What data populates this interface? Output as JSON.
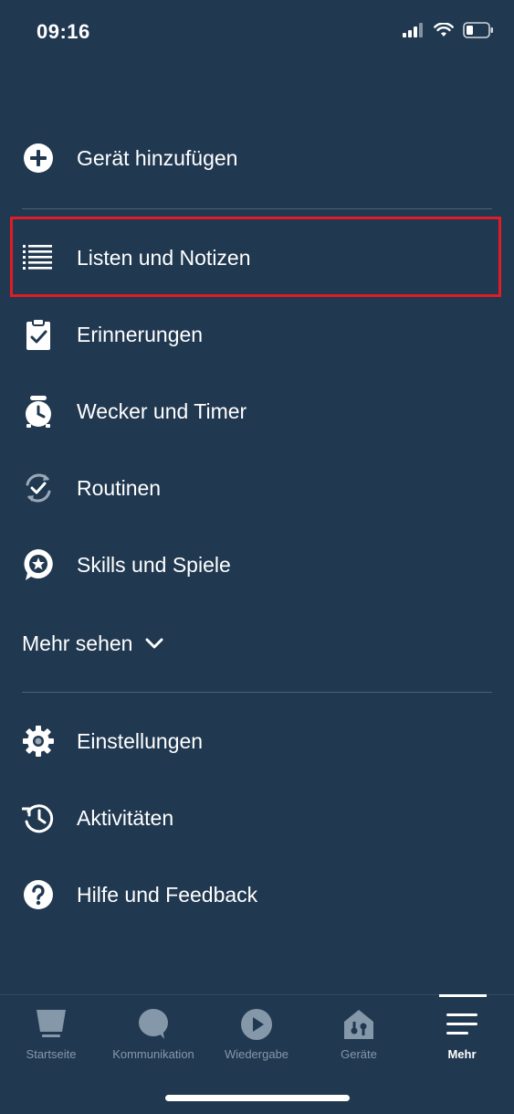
{
  "status_bar": {
    "time": "09:16"
  },
  "menu": {
    "items": [
      {
        "label": "Gerät hinzufügen",
        "icon": "plus-circle-icon"
      },
      {
        "label": "Listen und Notizen",
        "icon": "list-icon"
      },
      {
        "label": "Erinnerungen",
        "icon": "clipboard-check-icon"
      },
      {
        "label": "Wecker und Timer",
        "icon": "alarm-clock-icon"
      },
      {
        "label": "Routinen",
        "icon": "routine-icon"
      },
      {
        "label": "Skills und Spiele",
        "icon": "skills-icon"
      }
    ],
    "more_label": "Mehr sehen",
    "settings_items": [
      {
        "label": "Einstellungen",
        "icon": "gear-icon"
      },
      {
        "label": "Aktivitäten",
        "icon": "history-icon"
      },
      {
        "label": "Hilfe und Feedback",
        "icon": "help-icon"
      }
    ]
  },
  "bottom_nav": {
    "tabs": [
      {
        "label": "Startseite",
        "icon": "home-icon"
      },
      {
        "label": "Kommunikation",
        "icon": "chat-icon"
      },
      {
        "label": "Wiedergabe",
        "icon": "play-icon"
      },
      {
        "label": "Geräte",
        "icon": "devices-icon"
      },
      {
        "label": "Mehr",
        "icon": "menu-icon"
      }
    ],
    "active": "Mehr"
  },
  "colors": {
    "background": "#203850",
    "highlight": "#e21b24",
    "inactive_tab": "#8598a9"
  }
}
